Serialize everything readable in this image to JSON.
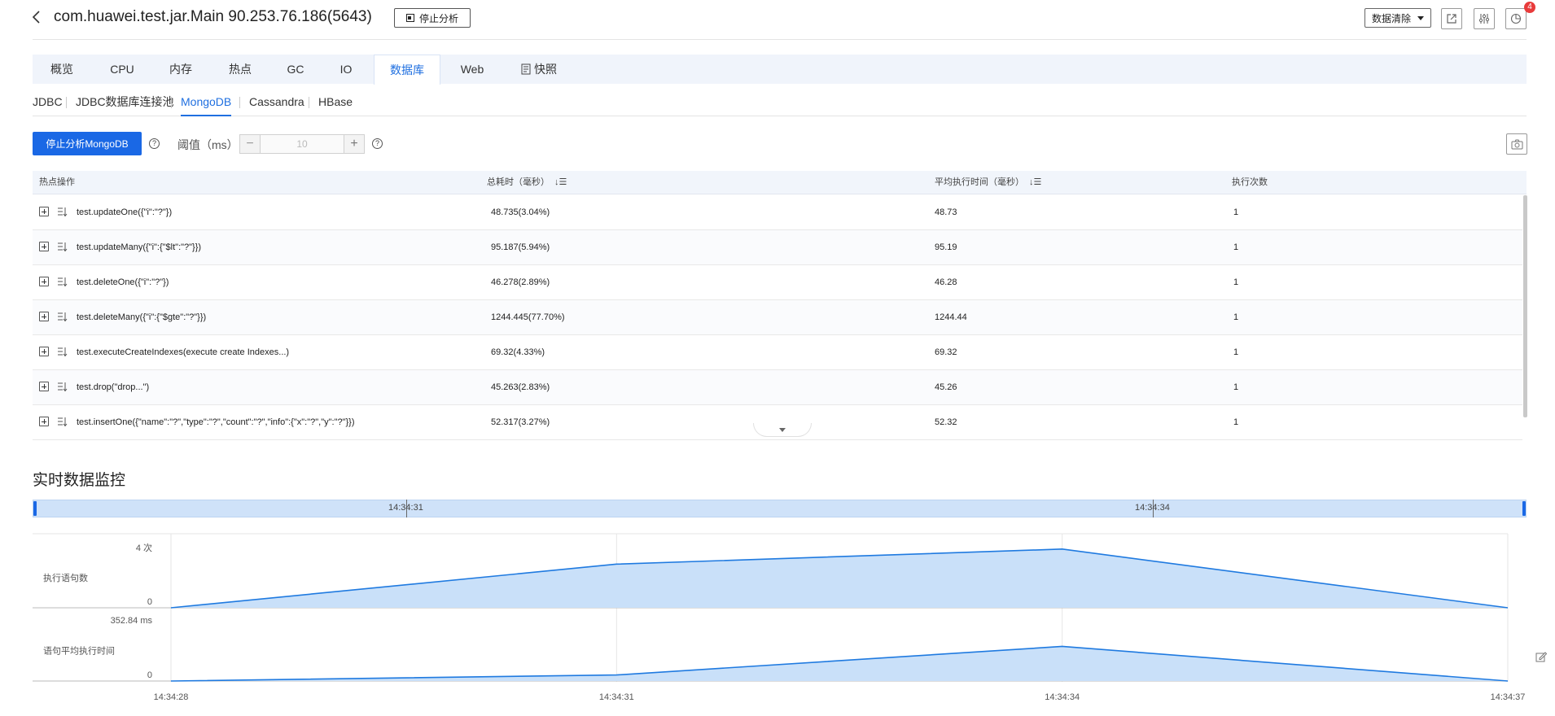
{
  "header": {
    "title": "com.huawei.test.jar.Main 90.253.76.186(5643)",
    "stop_label": "停止分析",
    "clear_label": "数据清除",
    "notification_count": "4"
  },
  "tabs": [
    "概览",
    "CPU",
    "内存",
    "热点",
    "GC",
    "IO",
    "数据库",
    "Web",
    "快照"
  ],
  "active_tab": "数据库",
  "subtabs": [
    "JDBC",
    "JDBC数据库连接池",
    "MongoDB",
    "Cassandra",
    "HBase"
  ],
  "active_subtab": "MongoDB",
  "controls": {
    "primary_label": "停止分析MongoDB",
    "threshold_label": "阈值（ms）",
    "threshold_placeholder": "10",
    "minus": "−",
    "plus": "+",
    "help": "?"
  },
  "table": {
    "headers": [
      "热点操作",
      "总耗时（毫秒）",
      "平均执行时间（毫秒）",
      "执行次数"
    ],
    "rows": [
      {
        "op": "test.updateOne({\"i\":\"?\"})",
        "total": "48.735(3.04%)",
        "avg": "48.73",
        "count": "1"
      },
      {
        "op": "test.updateMany({\"i\":{\"$lt\":\"?\"}})",
        "total": "95.187(5.94%)",
        "avg": "95.19",
        "count": "1"
      },
      {
        "op": "test.deleteOne({\"i\":\"?\"})",
        "total": "46.278(2.89%)",
        "avg": "46.28",
        "count": "1"
      },
      {
        "op": "test.deleteMany({\"i\":{\"$gte\":\"?\"}})",
        "total": "1244.445(77.70%)",
        "avg": "1244.44",
        "count": "1"
      },
      {
        "op": "test.executeCreateIndexes(execute create Indexes...)",
        "total": "69.32(4.33%)",
        "avg": "69.32",
        "count": "1"
      },
      {
        "op": "test.drop(\"drop...\")",
        "total": "45.263(2.83%)",
        "avg": "45.26",
        "count": "1"
      },
      {
        "op": "test.insertOne({\"name\":\"?\",\"type\":\"?\",\"count\":\"?\",\"info\":{\"x\":\"?\",\"y\":\"?\"}})",
        "total": "52.317(3.27%)",
        "avg": "52.32",
        "count": "1"
      }
    ]
  },
  "monitor": {
    "title": "实时数据监控",
    "slider_labels": [
      "14:34:31",
      "14:34:34"
    ]
  },
  "colors": {
    "accent": "#1a68e5",
    "area_fill": "#c9e0f9",
    "line": "#1f7ae0",
    "badge": "#e83b3b"
  },
  "chart_data": {
    "type": "area",
    "x": [
      "14:34:28",
      "14:34:31",
      "14:34:34",
      "14:34:37"
    ],
    "series": [
      {
        "name": "执行语句数",
        "ymax_label": "4 次",
        "ymin_label": "0",
        "ylim": [
          0,
          4
        ],
        "values": [
          0,
          2.9,
          3.9,
          0
        ]
      },
      {
        "name": "语句平均执行时间",
        "ymax_label": "352.84 ms",
        "ymin_label": "0",
        "ylim": [
          0,
          352.84
        ],
        "values": [
          0,
          35,
          200,
          0
        ]
      }
    ]
  }
}
